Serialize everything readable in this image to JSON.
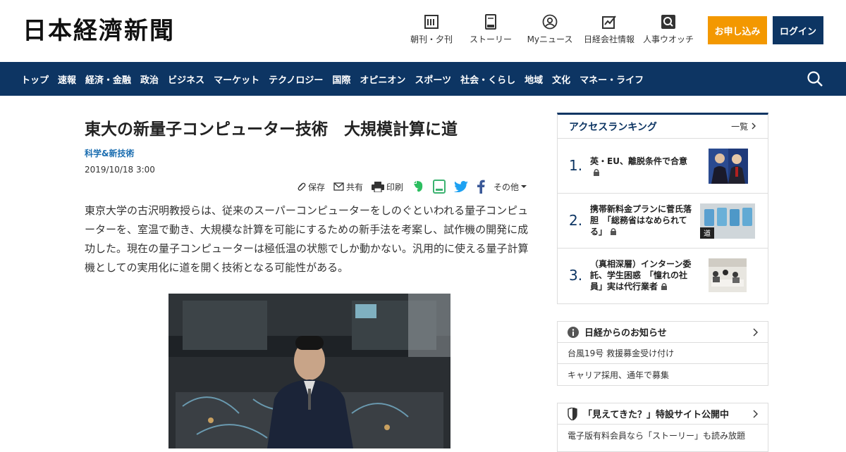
{
  "header": {
    "logo": "日本経濟新聞",
    "icons": [
      {
        "label": "朝刊・夕刊",
        "icon": "newspaper-icon"
      },
      {
        "label": "ストーリー",
        "icon": "book-icon"
      },
      {
        "label": "Myニュース",
        "icon": "user-icon"
      },
      {
        "label": "日経会社情報",
        "icon": "chart-icon"
      },
      {
        "label": "人事ウオッチ",
        "icon": "magnifier-icon"
      }
    ],
    "apply_label": "お申し込み",
    "login_label": "ログイン"
  },
  "nav": {
    "items": [
      "トップ",
      "速報",
      "経済・金融",
      "政治",
      "ビジネス",
      "マーケット",
      "テクノロジー",
      "国際",
      "オピニオン",
      "スポーツ",
      "社会・くらし",
      "地域",
      "文化",
      "マネー・ライフ"
    ]
  },
  "article": {
    "title": "東大の新量子コンピューター技術　大規模計算に道",
    "category": "科学&新技術",
    "date": "2019/10/18 3:00",
    "share": {
      "save": "保存",
      "share": "共有",
      "print": "印刷",
      "more": "その他"
    },
    "lead": "東京大学の古沢明教授らは、従来のスーパーコンピューターをしのぐといわれる量子コンピューターを、室温で動き、大規模な計算を可能にするための新手法を考案し、試作機の開発に成功した。現在の量子コンピューターは極低温の状態でしか動かない。汎用的に使える量子計算機としての実用化に道を開く技術となる可能性がある。"
  },
  "sidebar": {
    "ranking": {
      "title": "アクセスランキング",
      "more": "一覧",
      "items": [
        {
          "num": "1.",
          "text": "英・EU、離脱条件で合意"
        },
        {
          "num": "2.",
          "text": "携帯新料金プランに菅氏落胆　「総務省はなめられてる」"
        },
        {
          "num": "3.",
          "text": "（真相深層）インターン委託、学生困惑　「憧れの社員」実は代行業者"
        }
      ]
    },
    "info": {
      "title": "日経からのお知らせ",
      "rows": [
        "台風19号 救援募金受け付け",
        "キャリア採用、通年で募集"
      ]
    },
    "special": {
      "title": "「見えてきた？」特設サイト公開中",
      "rows": [
        "電子版有料会員なら「ストーリー」も読み放題"
      ]
    }
  },
  "colors": {
    "navy": "#0d3563",
    "orange": "#f39800",
    "link_blue": "#1a6db0"
  }
}
